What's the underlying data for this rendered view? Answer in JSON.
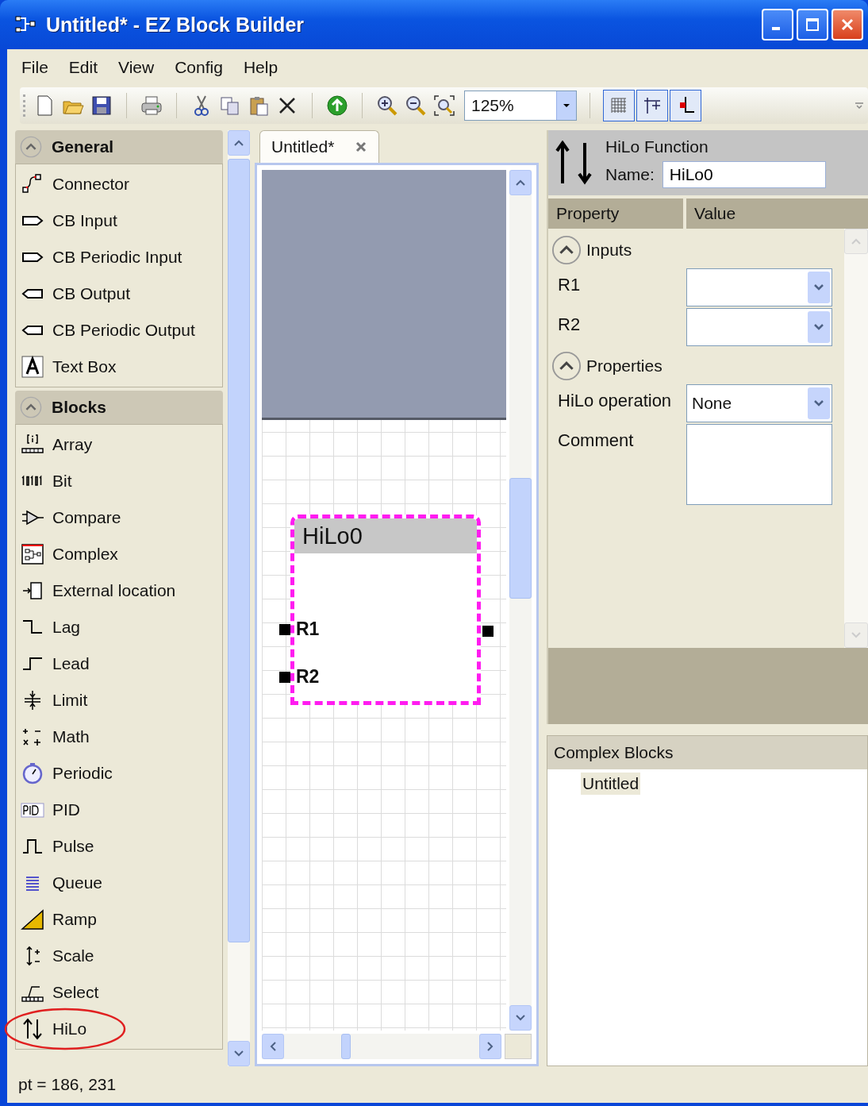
{
  "window": {
    "title": "Untitled* - EZ Block Builder"
  },
  "menu": [
    "File",
    "Edit",
    "View",
    "Config",
    "Help"
  ],
  "toolbar": {
    "zoom": "125%"
  },
  "toolbox": {
    "groups": [
      {
        "title": "General",
        "expanded": true,
        "items": [
          {
            "label": "Connector",
            "circled": false
          },
          {
            "label": "CB Input",
            "circled": false
          },
          {
            "label": "CB Periodic Input",
            "circled": false
          },
          {
            "label": "CB Output",
            "circled": false
          },
          {
            "label": "CB Periodic Output",
            "circled": false
          },
          {
            "label": "Text Box",
            "circled": false
          }
        ]
      },
      {
        "title": "Blocks",
        "expanded": true,
        "items": [
          {
            "label": "Array",
            "circled": false
          },
          {
            "label": "Bit",
            "circled": false
          },
          {
            "label": "Compare",
            "circled": false
          },
          {
            "label": "Complex",
            "circled": false
          },
          {
            "label": "External location",
            "circled": false
          },
          {
            "label": "Lag",
            "circled": false
          },
          {
            "label": "Lead",
            "circled": false
          },
          {
            "label": "Limit",
            "circled": false
          },
          {
            "label": "Math",
            "circled": false
          },
          {
            "label": "Periodic",
            "circled": false
          },
          {
            "label": "PID",
            "circled": false
          },
          {
            "label": "Pulse",
            "circled": false
          },
          {
            "label": "Queue",
            "circled": false
          },
          {
            "label": "Ramp",
            "circled": false
          },
          {
            "label": "Scale",
            "circled": false
          },
          {
            "label": "Select",
            "circled": false
          },
          {
            "label": "HiLo",
            "circled": true
          }
        ]
      }
    ]
  },
  "document": {
    "tabs": [
      {
        "label": "Untitled*",
        "selected": true
      }
    ],
    "block": {
      "name": "HiLo0",
      "selected": true,
      "inputs": [
        "R1",
        "R2"
      ]
    }
  },
  "inspector": {
    "title": "HiLo Function",
    "name_label": "Name:",
    "name_value": "HiLo0",
    "columns": [
      "Property",
      "Value"
    ],
    "sections": [
      {
        "title": "Inputs",
        "expanded": true,
        "rows": [
          {
            "label": "R1",
            "kind": "dropdown"
          },
          {
            "label": "R2",
            "kind": "dropdown"
          }
        ]
      },
      {
        "title": "Properties",
        "expanded": true,
        "rows": [
          {
            "label": "HiLo operation",
            "kind": "dropdown",
            "value": "None"
          },
          {
            "label": "Comment",
            "kind": "textarea"
          }
        ]
      }
    ]
  },
  "complex_blocks": {
    "title": "Complex Blocks",
    "items": [
      {
        "label": "Untitled",
        "selected": true
      }
    ]
  },
  "status_bar": "pt = 186, 231"
}
